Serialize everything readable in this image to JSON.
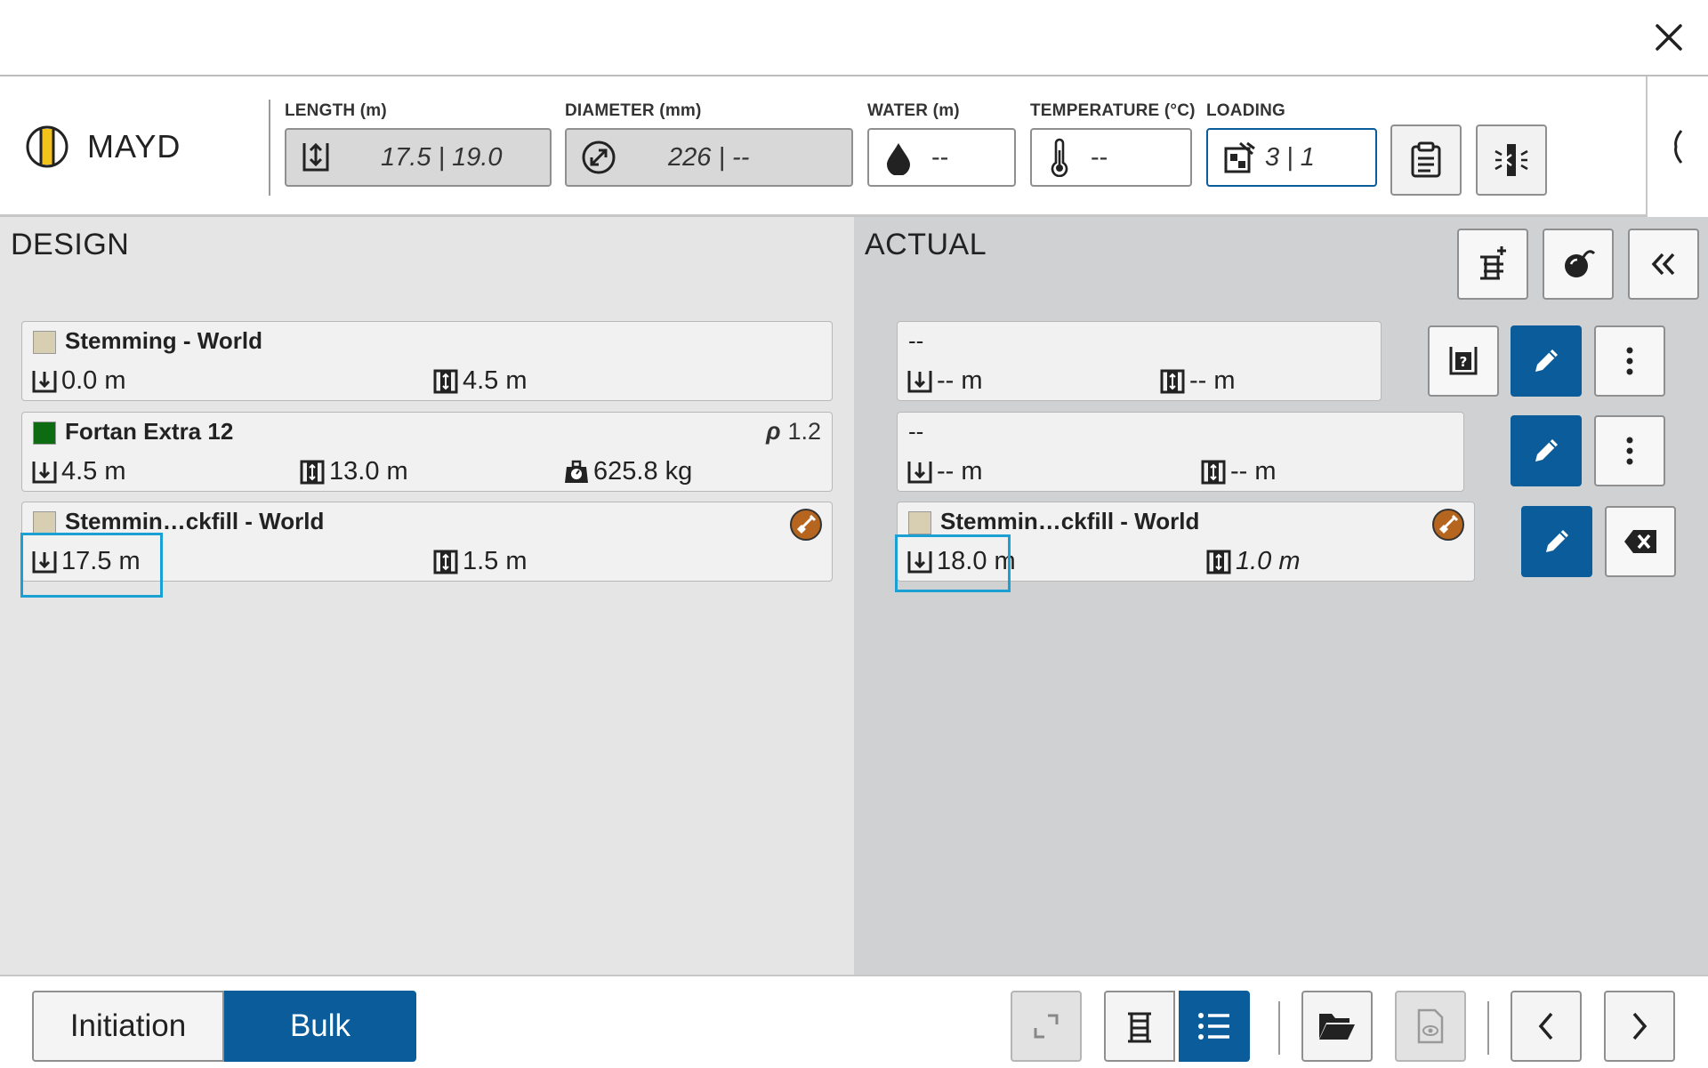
{
  "hole": {
    "name": "MAYD"
  },
  "header": {
    "length": {
      "label": "LENGTH (m)",
      "value": "17.5 | 19.0"
    },
    "diameter": {
      "label": "DIAMETER (mm)",
      "value": "226 | --"
    },
    "water": {
      "label": "WATER (m)",
      "value": "--"
    },
    "temperature": {
      "label": "TEMPERATURE (°C)",
      "value": "--"
    },
    "loading": {
      "label": "LOADING",
      "value": "3 | 1"
    }
  },
  "design": {
    "title": "DESIGN",
    "decks": [
      {
        "name": "Stemming - World",
        "color": "#d8cfb2",
        "depth": "0.0 m",
        "length": "4.5 m"
      },
      {
        "name": "Fortan Extra 12",
        "color": "#0d6b12",
        "depth": "4.5 m",
        "length": "13.0 m",
        "mass": "625.8 kg",
        "density_symbol": "ρ",
        "density": "1.2"
      },
      {
        "name": "Stemmin…ckfill - World",
        "color": "#d8cfb2",
        "depth": "17.5 m",
        "length": "1.5 m"
      }
    ]
  },
  "actual": {
    "title": "ACTUAL",
    "decks": [
      {
        "name": "--",
        "depth": "-- m",
        "length": "-- m"
      },
      {
        "name": "--",
        "depth": "-- m",
        "length": "-- m"
      },
      {
        "name": "Stemmin…ckfill - World",
        "color": "#d8cfb2",
        "depth": "18.0 m",
        "length": "1.0 m"
      }
    ]
  },
  "bottom": {
    "tabs": [
      "Initiation",
      "Bulk"
    ],
    "active_tab": "Bulk"
  },
  "colors": {
    "accent": "#0b5c9b",
    "highlight": "#1aa0d2",
    "tool_badge": "#b5651d"
  }
}
